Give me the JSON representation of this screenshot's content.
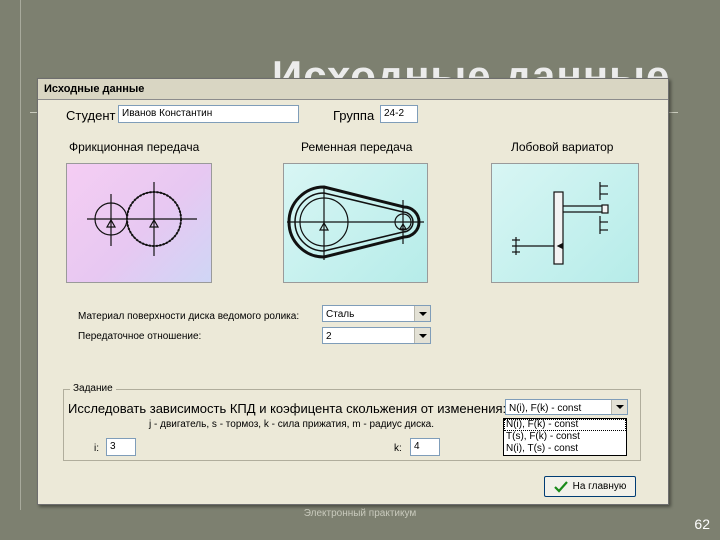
{
  "slide": {
    "bg_title": "Исходные данные",
    "footer": "Электронный практикум",
    "page_number": "62"
  },
  "window": {
    "title": "Исходные данные",
    "student_label": "Студент",
    "student_value": "Иванов Константин",
    "group_label": "Группа",
    "group_value": "24-2",
    "pictures": [
      {
        "label": "Фрикционная передача",
        "icon": "friction-gear-diagram"
      },
      {
        "label": "Ременная передача",
        "icon": "belt-drive-diagram"
      },
      {
        "label": "Лобовой вариатор",
        "icon": "face-variator-diagram"
      }
    ],
    "material_label": "Материал поверхности диска ведомого ролика:",
    "material_value": "Сталь",
    "ratio_label": "Передаточное отношение:",
    "ratio_value": "2",
    "task": {
      "legend": "Задание",
      "text": "Исследовать зависимость КПД и коэфицента скольжения от изменения:",
      "select_value": "N(i), F(k) - const",
      "options": [
        "N(i), F(k) - const",
        "T(s), F(k) - const",
        "N(i), T(s) - const"
      ],
      "hint": "j - двигатель, s - тормоз, k - сила прижатия, m - радиус диска.",
      "i_label": "i:",
      "i_value": "3",
      "k_label": "k:",
      "k_value": "4"
    },
    "home_button": "На главную"
  }
}
